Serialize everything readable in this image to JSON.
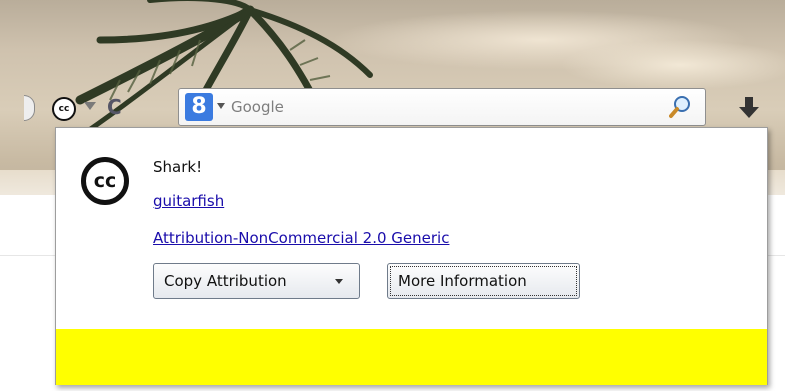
{
  "toolbar": {
    "search_placeholder": "Google",
    "cc_icon_label": "cc",
    "reload_glyph": "C",
    "search_engine_logo": "8"
  },
  "popup": {
    "cc_logo_text": "cc",
    "work_title": "Shark!",
    "author": "guitarfish",
    "license": "Attribution-NonCommercial 2.0 Generic",
    "copy_button_label": "Copy Attribution",
    "info_button_label": "More Information"
  },
  "colors": {
    "highlight_bar": "#ffff00",
    "link": "#1a0dab"
  }
}
